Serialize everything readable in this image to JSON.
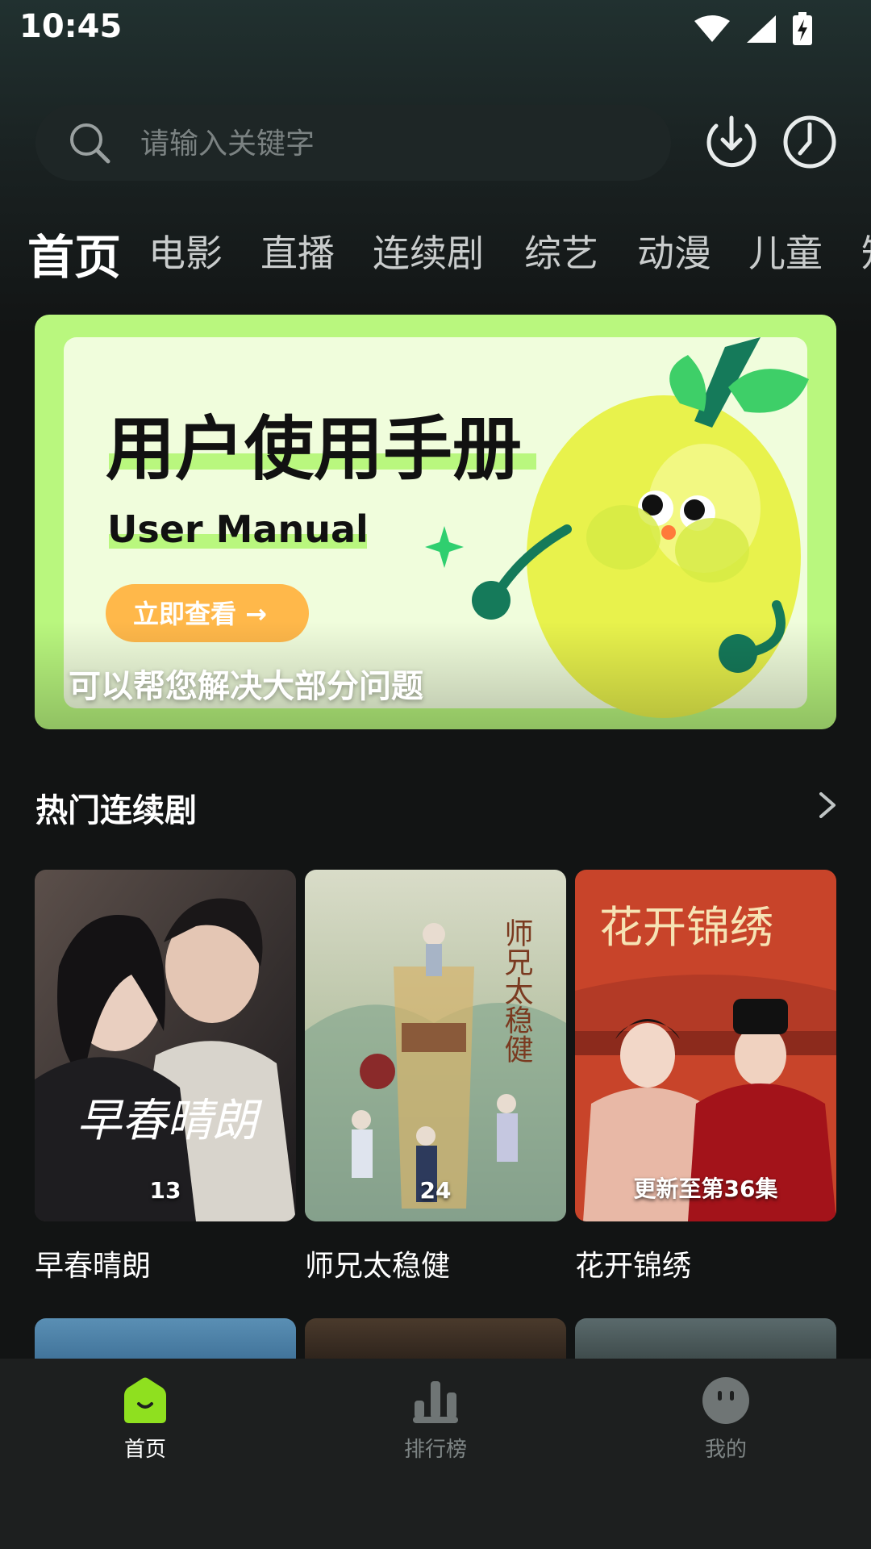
{
  "status_bar": {
    "time": "10:45"
  },
  "search": {
    "placeholder": "请输入关键字"
  },
  "tabs": [
    {
      "label": "首页",
      "active": true
    },
    {
      "label": "电影"
    },
    {
      "label": "直播"
    },
    {
      "label": "连续剧"
    },
    {
      "label": "综艺"
    },
    {
      "label": "动漫"
    },
    {
      "label": "儿童"
    },
    {
      "label": "知"
    }
  ],
  "banner": {
    "headline": "用户使用手册",
    "subheadline": "User Manual",
    "button_label": "立即查看 →",
    "caption": "可以帮您解决大部分问题"
  },
  "section": {
    "title": "热门连续剧"
  },
  "dramas": [
    {
      "title": "早春晴朗",
      "badge": "13",
      "poster_text": "早春晴朗"
    },
    {
      "title": "师兄太稳健",
      "badge": "24",
      "poster_text": "师兄太稳健"
    },
    {
      "title": "花开锦绣",
      "badge": "更新至第36集",
      "poster_text": "花开锦绣"
    }
  ],
  "bottom_nav": [
    {
      "label": "首页",
      "icon": "home-smile-icon",
      "active": true
    },
    {
      "label": "排行榜",
      "icon": "bar-chart-icon"
    },
    {
      "label": "我的",
      "icon": "profile-face-icon"
    }
  ],
  "colors": {
    "accent": "#8fe01f",
    "background": "#121414",
    "nav_background": "#1d1f1f"
  }
}
